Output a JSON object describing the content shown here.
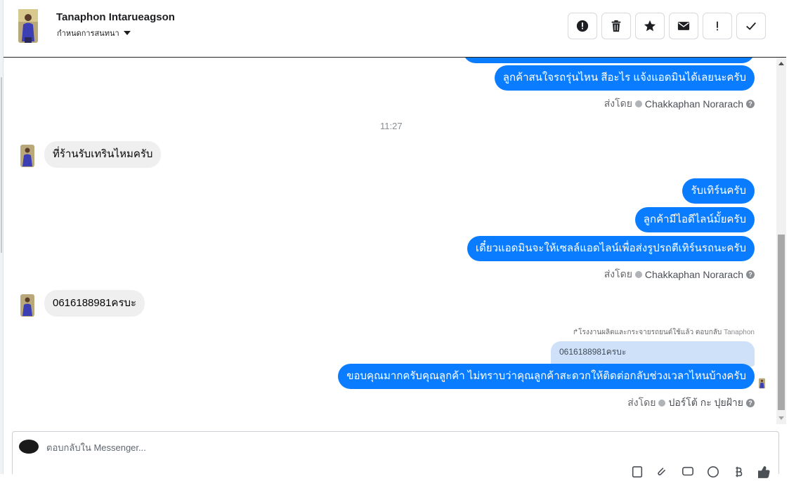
{
  "header": {
    "name": "Tanaphon Intarueagson",
    "assign_label": "กำหนดการสนทนา"
  },
  "actions": [
    {
      "name": "report-button",
      "icon": "alert-circle-icon"
    },
    {
      "name": "delete-button",
      "icon": "trash-icon"
    },
    {
      "name": "star-button",
      "icon": "star-icon"
    },
    {
      "name": "email-button",
      "icon": "envelope-icon"
    },
    {
      "name": "spam-button",
      "icon": "exclamation-icon"
    },
    {
      "name": "done-button",
      "icon": "check-icon"
    }
  ],
  "conversation": {
    "out_1": "ลูกค้าสนใจรถรุ่นไหน สีอะไร แจ้งแอดมินได้เลยนะครับ",
    "sent_by_prefix": "ส่งโดย",
    "agent_1": "Chakkaphan Norarach",
    "time_1": "11:27",
    "in_1": "ที่ร้านรับเทรินไหมครับ",
    "out_2": "รับเทิร์นครับ",
    "out_3": "ลูกค้ามีไอดีไลน์มั้ยครับ",
    "out_4": "เดี๋ยวแอดมินจะให้เซลล์แอดไลน์เพื่อส่งรูปรถตีเทิร์นรถนะครับ",
    "agent_2": "Chakkaphan Norarach",
    "in_2": "0616188981ครบะ",
    "reply_meta": "↱โรงงานผลิตและกระจายรถยนต์ใช้แล้ว ตอบกลับ",
    "reply_target": "Tanaphon",
    "quote": "0616188981ครบะ",
    "out_5": "ขอบคุณมากครับคุณลูกค้า ไม่ทราบว่าคุณลูกค้าสะดวกให้ติดต่อกลับช่วงเวลาไหนบ้างครับ",
    "agent_3": "ปอร์โต้ กะ ปุยฝ้าย"
  },
  "composer": {
    "placeholder": "ตอบกลับใน Messenger..."
  },
  "colors": {
    "outgoing": "#0a7cff",
    "incoming": "#efefef",
    "quote": "#cfe1f9"
  }
}
